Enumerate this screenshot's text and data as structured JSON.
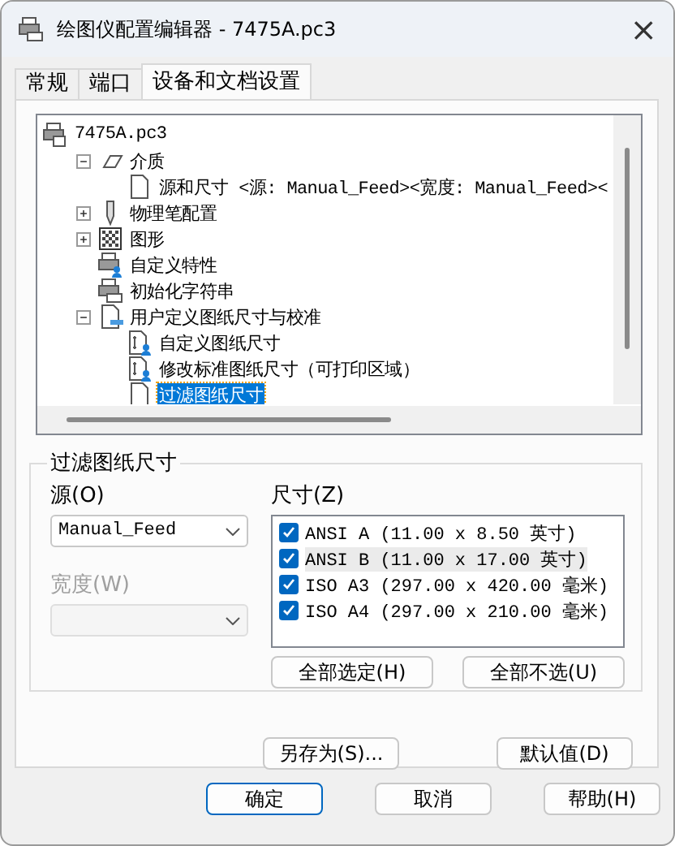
{
  "window": {
    "title": "绘图仪配置编辑器 - 7475A.pc3",
    "close": "×"
  },
  "tabs": [
    {
      "label": "常规",
      "selected": false
    },
    {
      "label": "端口",
      "selected": false
    },
    {
      "label": "设备和文档设置",
      "selected": true
    }
  ],
  "tree": [
    {
      "label": "7475A.pc3",
      "kind": "printer",
      "selected": false,
      "children": [
        {
          "label": "介质",
          "kind": "media",
          "expanded": true,
          "selected": false,
          "children": [
            {
              "label": "源和尺寸 <源:  Manual_Feed><宽度: Manual_Feed><",
              "kind": "page",
              "selected": false
            }
          ]
        },
        {
          "label": "物理笔配置",
          "kind": "pen",
          "expanded": false,
          "selected": false
        },
        {
          "label": "图形",
          "kind": "pattern",
          "expanded": false,
          "selected": false
        },
        {
          "label": "自定义特性",
          "kind": "printer-user",
          "selected": false
        },
        {
          "label": "初始化字符串",
          "kind": "printer-doc",
          "selected": false
        },
        {
          "label": "用户定义图纸尺寸与校准",
          "kind": "doc-blue",
          "expanded": true,
          "selected": false,
          "children": [
            {
              "label": "自定义图纸尺寸",
              "kind": "doc-user",
              "selected": false
            },
            {
              "label": "修改标准图纸尺寸（可打印区域）",
              "kind": "doc-user",
              "selected": false
            },
            {
              "label": "过滤图纸尺寸",
              "kind": "page",
              "selected": true
            }
          ]
        }
      ]
    }
  ],
  "group": {
    "title": "过滤图纸尺寸",
    "source": {
      "label": "源(O)",
      "value": "Manual_Feed",
      "disabled": false
    },
    "width": {
      "label": "宽度(W)",
      "disabled": true
    },
    "sizes": {
      "label": "尺寸(Z)",
      "items": [
        {
          "label": "ANSI A (11.00 x 8.50 英寸)",
          "checked": true,
          "selected": false
        },
        {
          "label": "ANSI B (11.00 x 17.00 英寸)",
          "checked": true,
          "selected": true
        },
        {
          "label": "ISO A3 (297.00 x 420.00 毫米)",
          "checked": true,
          "selected": false
        },
        {
          "label": "ISO A4 (297.00 x 210.00 毫米)",
          "checked": true,
          "selected": false
        }
      ]
    },
    "buttons": [
      "全部选定(H)",
      "全部不选(U)"
    ]
  },
  "panel_buttons": [
    "另存为(S)...",
    "默认值(D)"
  ],
  "footer_buttons": [
    {
      "label": "确定",
      "default": true
    },
    {
      "label": "取消",
      "default": false
    },
    {
      "label": "帮助(H)",
      "default": false
    }
  ]
}
